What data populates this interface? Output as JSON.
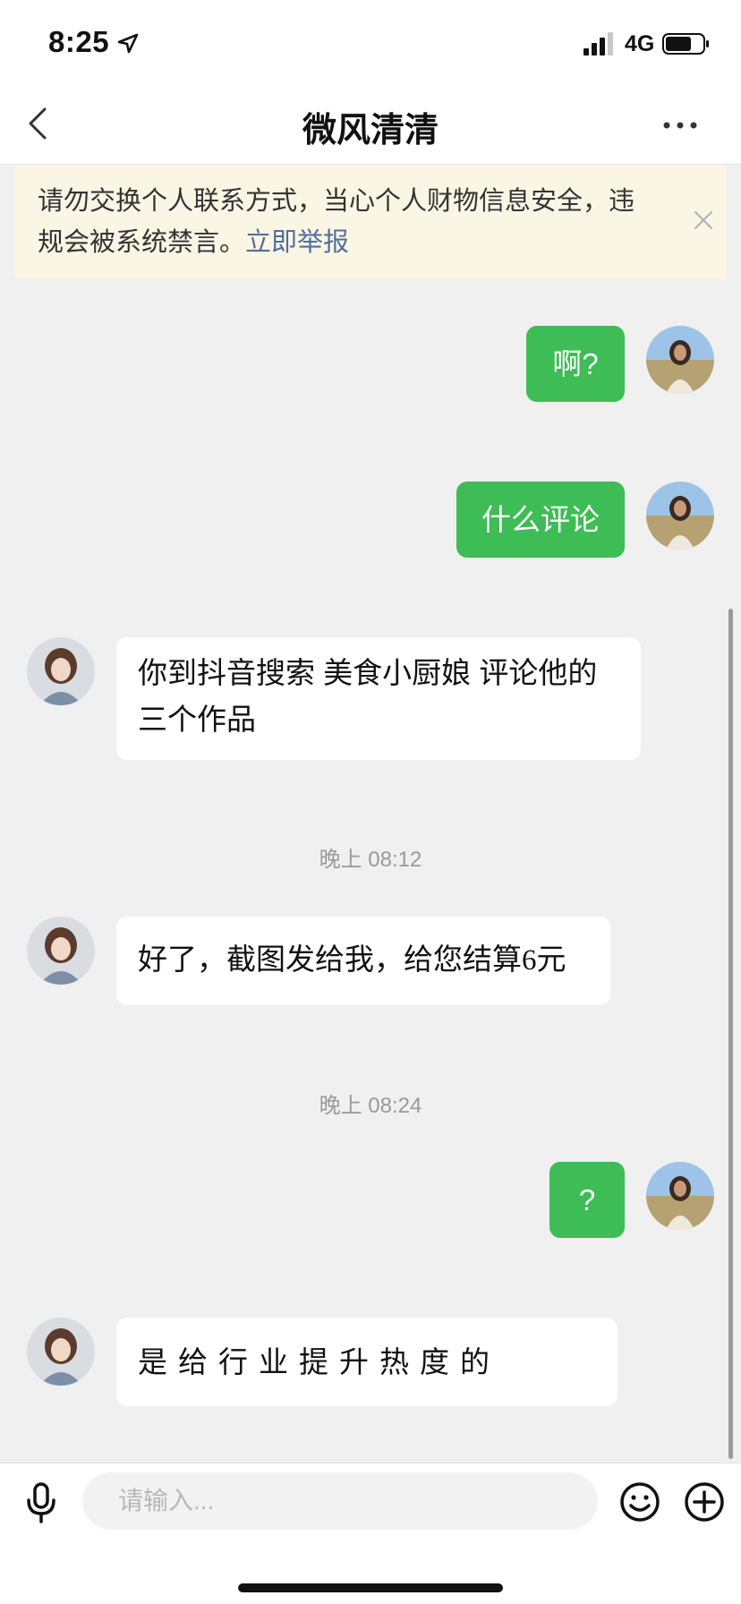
{
  "status_bar": {
    "time": "8:25",
    "network": "4G"
  },
  "nav": {
    "title": "微风清清"
  },
  "notice": {
    "text": "请勿交换个人联系方式，当心个人财物信息安全，违规会被系统禁言。",
    "link": "立即举报"
  },
  "messages": [
    {
      "side": "out",
      "text": "啊?"
    },
    {
      "side": "out",
      "text": "什么评论"
    },
    {
      "side": "in",
      "text": "你到抖音搜索 美食小厨娘 评论他的三个作品"
    },
    {
      "time": "晚上 08:12"
    },
    {
      "side": "in",
      "text": "好了，截图发给我，给您结算6元"
    },
    {
      "time": "晚上 08:24"
    },
    {
      "side": "out",
      "text": "?"
    },
    {
      "side": "in",
      "text": "是给行业提升热度的"
    }
  ],
  "input": {
    "placeholder": "请输入..."
  },
  "colors": {
    "outgoing_bubble": "#3ebc55",
    "notice_bg": "#fbf6e4",
    "link": "#4f6f9e",
    "chat_bg": "#f0f0f0"
  },
  "icons": [
    "location-arrow-icon",
    "signal-icon",
    "battery-icon",
    "back-chevron-icon",
    "more-dots-icon",
    "close-icon",
    "microphone-icon",
    "emoji-icon",
    "plus-icon"
  ]
}
